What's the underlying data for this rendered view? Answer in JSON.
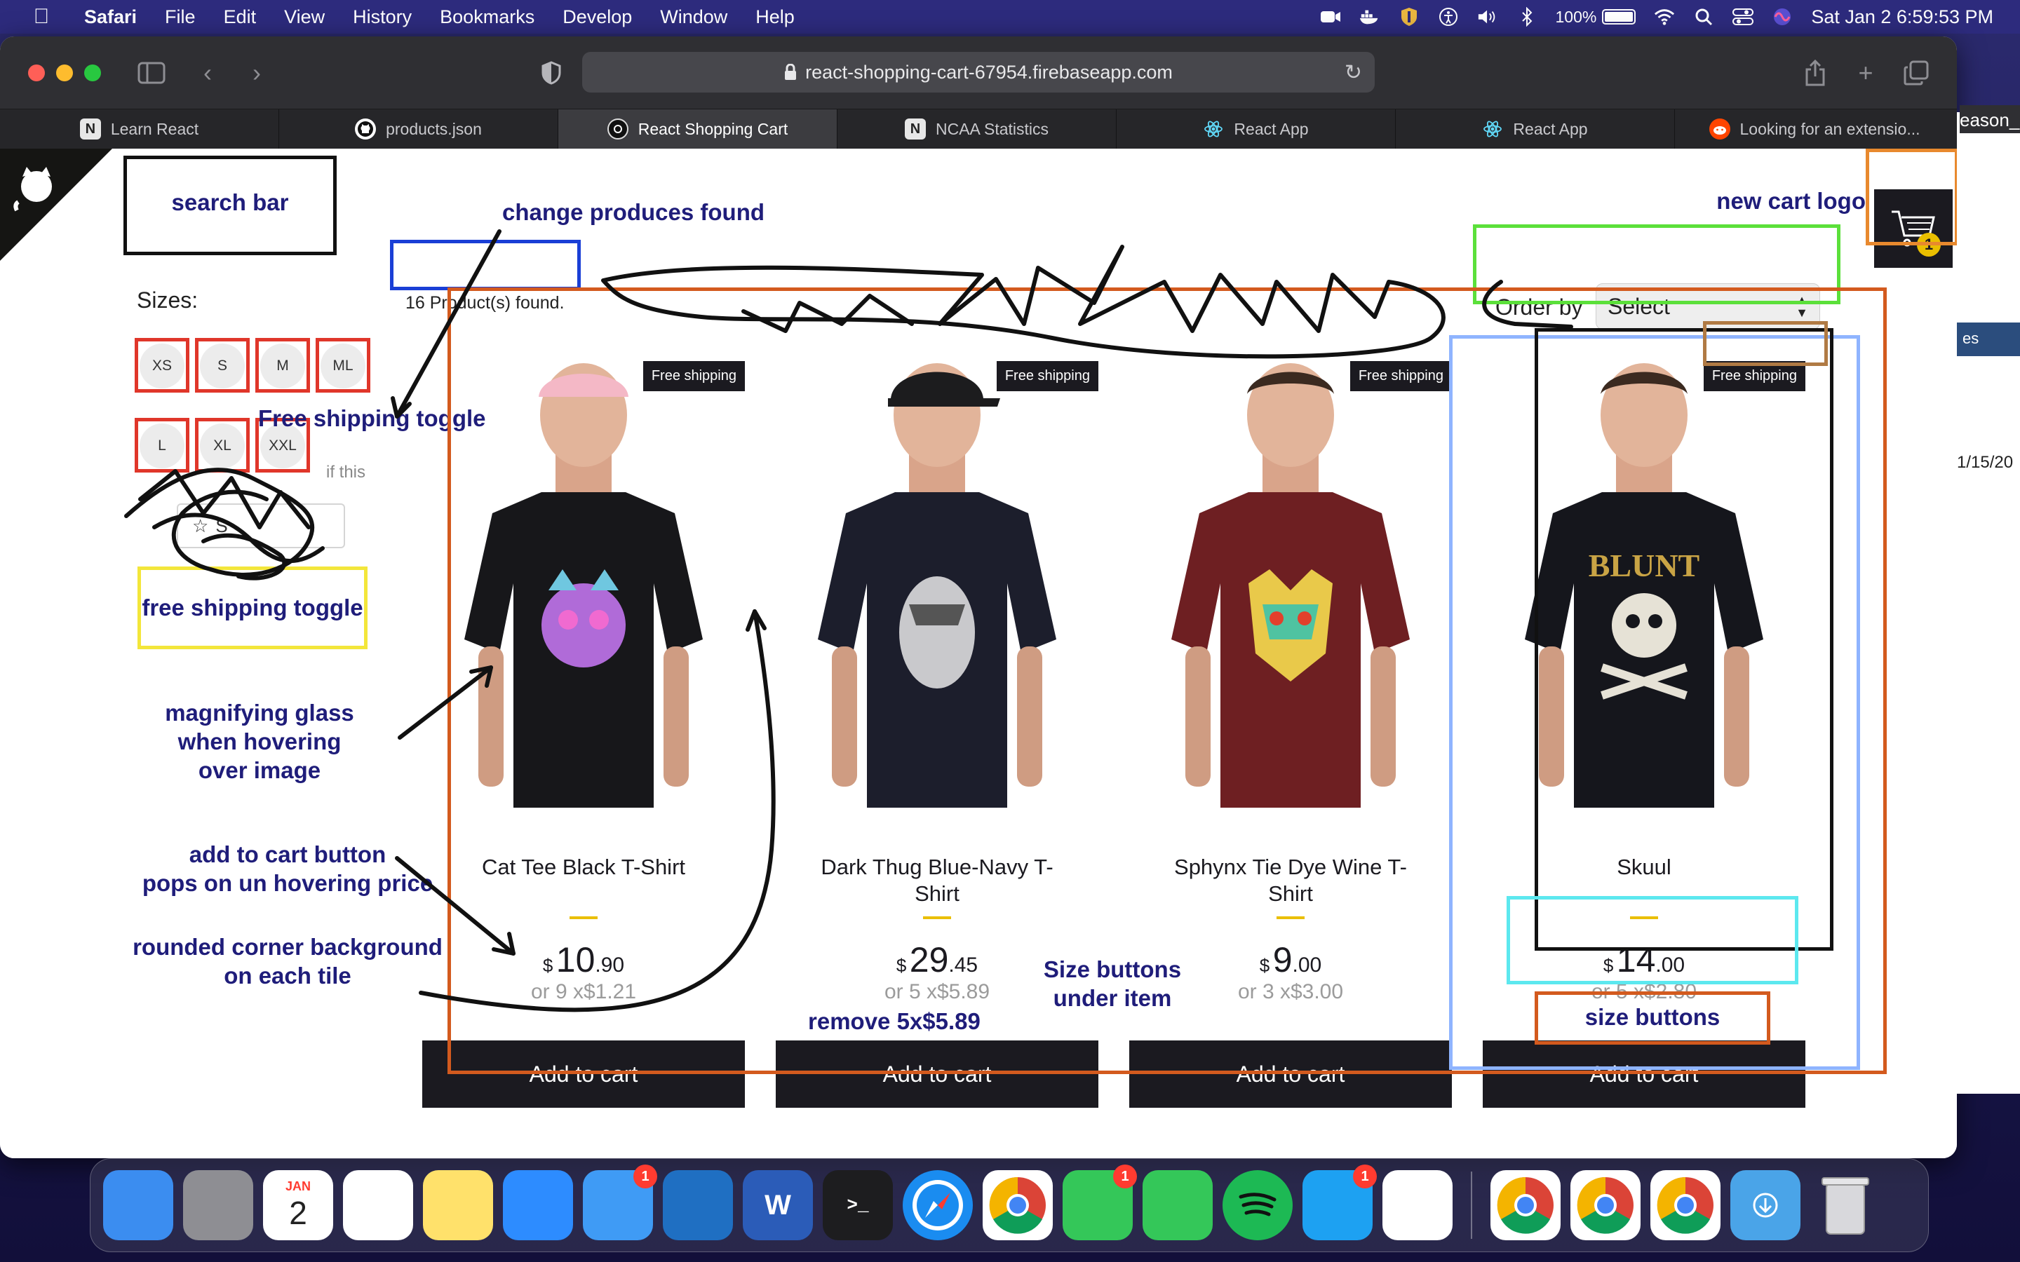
{
  "menubar": {
    "app_name": "Safari",
    "menus": [
      "File",
      "Edit",
      "View",
      "History",
      "Bookmarks",
      "Develop",
      "Window",
      "Help"
    ],
    "battery": "100%",
    "datetime": "Sat Jan 2  6:59:53 PM"
  },
  "browser": {
    "url": "react-shopping-cart-67954.firebaseapp.com",
    "tabs": [
      {
        "label": "Learn React",
        "icon": "N"
      },
      {
        "label": "products.json",
        "icon": "github"
      },
      {
        "label": "React Shopping Cart",
        "icon": "circle"
      },
      {
        "label": "NCAA Statistics",
        "icon": "N"
      },
      {
        "label": "React App",
        "icon": "react"
      },
      {
        "label": "React App",
        "icon": "react"
      },
      {
        "label": "Looking for an extensio...",
        "icon": "reddit"
      }
    ],
    "side_window_text": [
      "eason_",
      "es",
      "1/15/20"
    ]
  },
  "shop": {
    "sizes_title": "Sizes:",
    "sizes": [
      "XS",
      "S",
      "M",
      "ML",
      "L",
      "XL",
      "XXL"
    ],
    "products_found": "16 Product(s) found.",
    "order_by_label": "Order by",
    "order_by_value": "Select",
    "cart_count": "1",
    "leftover_text": "if this",
    "star_button_text": "S",
    "products": [
      {
        "title": "Cat Tee Black T-Shirt",
        "currency": "$",
        "price_int": "10",
        "price_dec": ".90",
        "installments": "or 9 x$1.21",
        "free_shipping": "Free shipping",
        "add_label": "Add to cart",
        "shirt_color": "#17171a",
        "print": "cat"
      },
      {
        "title": "Dark Thug Blue-Navy T-Shirt",
        "currency": "$",
        "price_int": "29",
        "price_dec": ".45",
        "installments": "or 5 x$5.89",
        "free_shipping": "Free shipping",
        "add_label": "Add to cart",
        "shirt_color": "#1c1e2c",
        "print": "thug"
      },
      {
        "title": "Sphynx Tie Dye Wine T-Shirt",
        "currency": "$",
        "price_int": "9",
        "price_dec": ".00",
        "installments": "or 3 x$3.00",
        "free_shipping": "Free shipping",
        "add_label": "Add to cart",
        "shirt_color": "#6e1f22",
        "print": "sphynx"
      },
      {
        "title": "Skuul",
        "currency": "$",
        "price_int": "14",
        "price_dec": ".00",
        "installments": "or 5 x$2.80",
        "free_shipping": "Free shipping",
        "add_label": "Add to cart",
        "shirt_color": "#15161c",
        "print": "skull"
      }
    ]
  },
  "annotations": {
    "search_bar": "search bar",
    "change_found": "change produces found",
    "new_cart_logo": "new cart logo",
    "free_shipping_toggle_1": "Free shipping toggle",
    "free_shipping_toggle_2": "free shipping toggle",
    "magnifying": "magnifying glass\nwhen hovering\nover image",
    "add_to_cart_pops": "add to cart button\npops on un hovering price",
    "rounded_corner": "rounded corner background\non each tile",
    "remove_installments": "remove 5x$5.89",
    "size_buttons_under": "Size buttons\nunder item",
    "size_buttons": "size buttons"
  },
  "colors": {
    "accent_yellow": "#eabf00",
    "dark": "#1b1a20",
    "annotation_text": "#1f1d7a",
    "box_red": "#e0362a",
    "box_blue": "#1a3fd6",
    "box_green": "#5be03a",
    "box_orange": "#e8892e",
    "box_yellow": "#f3e63a",
    "box_lightblue": "#8fb4ff",
    "box_cyan": "#5ce8ef",
    "box_brown": "#b07a44",
    "box_darkorange": "#d35a1e"
  },
  "dock": {
    "apps": [
      {
        "name": "finder",
        "color": "#3b8df0"
      },
      {
        "name": "system-preferences",
        "color": "#8e8e93"
      },
      {
        "name": "calendar",
        "color": "#ffffff",
        "label": "2",
        "sublabel": "JAN"
      },
      {
        "name": "reminders",
        "color": "#ffffff"
      },
      {
        "name": "notes",
        "color": "#ffe16b"
      },
      {
        "name": "zoom",
        "color": "#2d8cff"
      },
      {
        "name": "mail",
        "color": "#3f9bf5",
        "badge": "1"
      },
      {
        "name": "vscode",
        "color": "#1f6fc2"
      },
      {
        "name": "word",
        "color": "#2b5cb8"
      },
      {
        "name": "terminal",
        "color": "#1d1d1f"
      },
      {
        "name": "safari",
        "color": "#1a8cf0"
      },
      {
        "name": "chrome",
        "color": "#ffffff"
      },
      {
        "name": "facetime",
        "color": "#34c759",
        "badge": "1"
      },
      {
        "name": "messages",
        "color": "#34c759"
      },
      {
        "name": "spotify",
        "color": "#1db954"
      },
      {
        "name": "twitter",
        "color": "#1da1f2",
        "badge": "1"
      },
      {
        "name": "slack",
        "color": "#ffffff"
      }
    ],
    "apps_right": [
      {
        "name": "chrome",
        "color": "#ffffff"
      },
      {
        "name": "chrome",
        "color": "#ffffff"
      },
      {
        "name": "chrome",
        "color": "#ffffff"
      },
      {
        "name": "downloads-folder",
        "color": "#4aa4e8"
      },
      {
        "name": "trash",
        "color": "#c7c7cc"
      }
    ]
  }
}
